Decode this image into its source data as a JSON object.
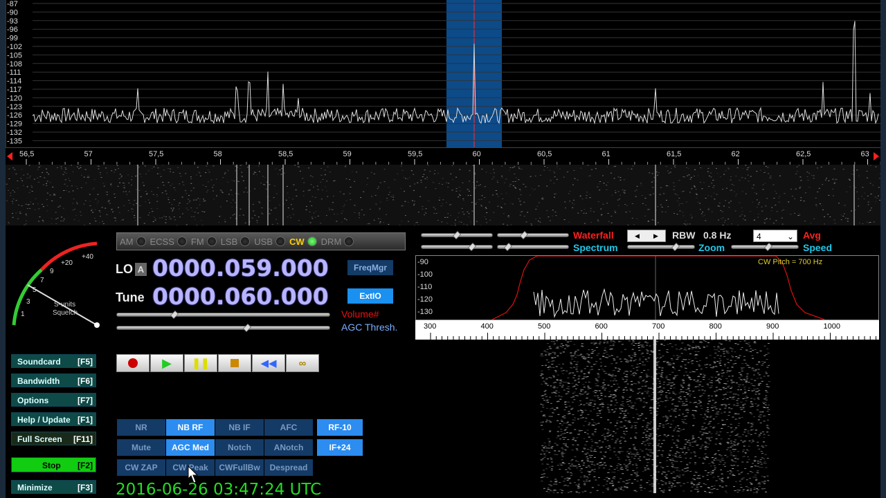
{
  "spectrum": {
    "db_ticks": [
      "-87",
      "-90",
      "-93",
      "-96",
      "-99",
      "-102",
      "-105",
      "-108",
      "-111",
      "-114",
      "-117",
      "-120",
      "-123",
      "-126",
      "-129",
      "-132",
      "-135"
    ],
    "freq_ticks": [
      "56,5",
      "57",
      "57,5",
      "58",
      "58,5",
      "59",
      "59,5",
      "60",
      "60,5",
      "61",
      "61,5",
      "62",
      "62,5",
      "63"
    ]
  },
  "smeter": {
    "scale_labels": [
      "1",
      "3",
      "5",
      "7",
      "9",
      "+20",
      "+40"
    ],
    "caption1": "S-units",
    "caption2": "Squelch"
  },
  "modes": [
    {
      "label": "AM",
      "active": false
    },
    {
      "label": "ECSS",
      "active": false
    },
    {
      "label": "FM",
      "active": false
    },
    {
      "label": "LSB",
      "active": false
    },
    {
      "label": "USB",
      "active": false
    },
    {
      "label": "CW",
      "active": true
    },
    {
      "label": "DRM",
      "active": false
    }
  ],
  "lo": {
    "label": "LO",
    "badge": "A",
    "value": "0000.059.000"
  },
  "tune": {
    "label": "Tune",
    "value": "0000.060.000"
  },
  "buttons": {
    "freqmgr": "FreqMgr",
    "extio": "ExtIO"
  },
  "labels": {
    "volume": "Volume#",
    "agc_thresh": "AGC Thresh."
  },
  "controls": [
    {
      "label": "NR",
      "on": false
    },
    {
      "label": "NB RF",
      "on": true
    },
    {
      "label": "NB IF",
      "on": false
    },
    {
      "label": "AFC",
      "on": false
    },
    {
      "label": "Mute",
      "on": false
    },
    {
      "label": "AGC Med",
      "on": true
    },
    {
      "label": "Notch",
      "on": false
    },
    {
      "label": "ANotch",
      "on": false
    },
    {
      "label": "CW ZAP",
      "on": false
    },
    {
      "label": "CW Peak",
      "on": false
    },
    {
      "label": "CWFullBw",
      "on": false
    },
    {
      "label": "Despread",
      "on": false
    }
  ],
  "gain": {
    "rf": "RF-10",
    "if": "IF+24"
  },
  "sidebar": [
    {
      "label": "Soundcard",
      "key": "[F5]"
    },
    {
      "label": "Bandwidth",
      "key": "[F6]"
    },
    {
      "label": "Options",
      "key": "[F7]"
    },
    {
      "label": "Help / Update",
      "key": "[F1]"
    },
    {
      "label": "Full Screen",
      "key": "[F11]"
    },
    {
      "label": "Stop",
      "key": "[F2]"
    },
    {
      "label": "Minimize",
      "key": "[F3]"
    }
  ],
  "datetime": "2016-06-26   03:47:24 UTC",
  "right": {
    "waterfall": "Waterfall",
    "spectrum": "Spectrum",
    "rbw_label": "RBW",
    "rbw_value": "0.8 Hz",
    "zoom": "Zoom",
    "avg_select": "4",
    "avg": "Avg",
    "speed": "Speed",
    "cw_pitch": "CW Pitch = 700 Hz",
    "db_ticks": [
      "-90",
      "-100",
      "-110",
      "-120",
      "-130"
    ],
    "hz_ticks": [
      "300",
      "400",
      "500",
      "600",
      "700",
      "800",
      "900",
      "1000"
    ]
  },
  "colors": {
    "accent_blue": "#2c8cf0",
    "waterfall_red": "#ff2020",
    "spectrum_cyan": "#22c8e8",
    "time_green": "#22dd22"
  }
}
